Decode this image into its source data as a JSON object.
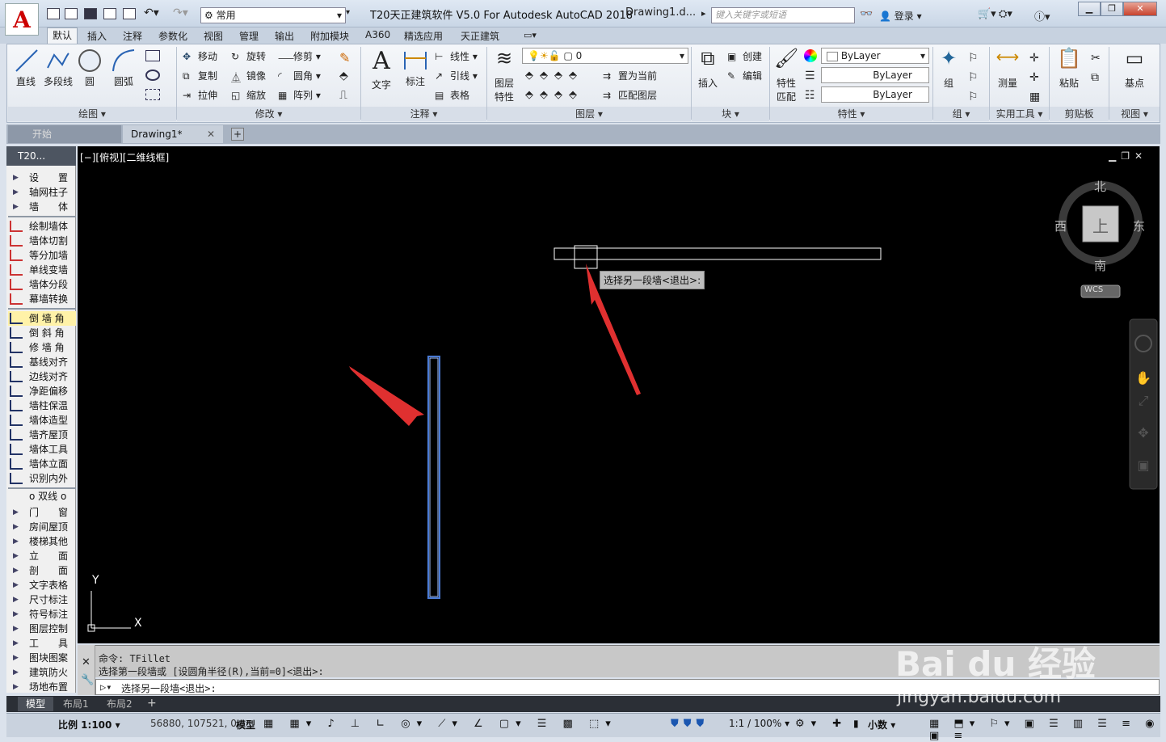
{
  "titlebar": {
    "title": "T20天正建筑软件 V5.0 For Autodesk AutoCAD 2018",
    "doc": "Drawing1.d...",
    "workspace": "常用",
    "search_placeholder": "键入关键字或短语",
    "login": "登录"
  },
  "ribbon_tabs": [
    "默认",
    "插入",
    "注释",
    "参数化",
    "视图",
    "管理",
    "输出",
    "附加模块",
    "A360",
    "精选应用",
    "天正建筑"
  ],
  "ribbon": {
    "draw": {
      "line": "直线",
      "polyline": "多段线",
      "circle": "圆",
      "arc": "圆弧",
      "panel": "绘图"
    },
    "modify": {
      "move": "移动",
      "rotate": "旋转",
      "trim": "修剪",
      "copy": "复制",
      "mirror": "镜像",
      "fillet": "圆角",
      "stretch": "拉伸",
      "scale": "缩放",
      "array": "阵列",
      "panel": "修改"
    },
    "annotation": {
      "text": "文字",
      "dim": "标注",
      "linear": "线性",
      "leader": "引线",
      "table": "表格",
      "panel": "注释"
    },
    "layers": {
      "props": "图层",
      "props2": "特性",
      "current_layer": "0",
      "make_current": "置为当前",
      "match_layer": "匹配图层",
      "panel": "图层"
    },
    "block": {
      "insert": "插入",
      "create": "创建",
      "edit": "编辑",
      "panel": "块"
    },
    "properties": {
      "match": "特性",
      "match2": "匹配",
      "color": "ByLayer",
      "linetype": "ByLayer",
      "lineweight": "ByLayer",
      "panel": "特性"
    },
    "groups": {
      "group": "组",
      "panel": "组"
    },
    "utilities": {
      "measure": "测量",
      "panel": "实用工具"
    },
    "clipboard": {
      "paste": "粘贴",
      "panel": "剪贴板"
    },
    "view": {
      "base": "基点",
      "panel": "视图"
    }
  },
  "doc_tabs": [
    "开始",
    "Drawing1*"
  ],
  "palette": {
    "title": "T20...",
    "items_a": [
      "设　　置",
      "轴网柱子",
      "墙　　体"
    ],
    "items_b": [
      "绘制墙体",
      "墙体切割",
      "等分加墙",
      "单线变墙",
      "墙体分段",
      "幕墙转换"
    ],
    "items_c": [
      "倒 墙 角",
      "倒 斜 角",
      "修 墙 角",
      "基线对齐",
      "边线对齐",
      "净距偏移",
      "墙柱保温",
      "墙体造型",
      "墙齐屋顶",
      "墙体工具",
      "墙体立面",
      "识别内外"
    ],
    "double_line": "o 双线 o",
    "items_d": [
      "门　　窗",
      "房间屋顶",
      "楼梯其他",
      "立　　面",
      "剖　　面",
      "文字表格",
      "尺寸标注",
      "符号标注",
      "图层控制",
      "工　　具",
      "图块图案",
      "建筑防火",
      "场地布置"
    ]
  },
  "viewport": {
    "label": "[−][俯视][二维线框]",
    "tooltip": "选择另一段墙<退出>:",
    "compass": {
      "north": "北",
      "south": "南",
      "east": "东",
      "west": "西",
      "top": "上",
      "wcs": "WCS"
    },
    "ucs": {
      "x": "X",
      "y": "Y"
    }
  },
  "command": {
    "line1": "命令: TFillet",
    "line2": "选择第一段墙或 [设圆角半径(R),当前=0]<退出>:",
    "prompt": "选择另一段墙<退出>:"
  },
  "layout_tabs": [
    "模型",
    "布局1",
    "布局2"
  ],
  "status": {
    "scale": "比例 1:100",
    "coords": "56880, 107521, 0",
    "model": "模型",
    "anno_scale": "1:1 / 100%",
    "units": "小数"
  },
  "watermark": {
    "brand": "Bai du 经验",
    "url": "jingyan.baidu.com"
  }
}
